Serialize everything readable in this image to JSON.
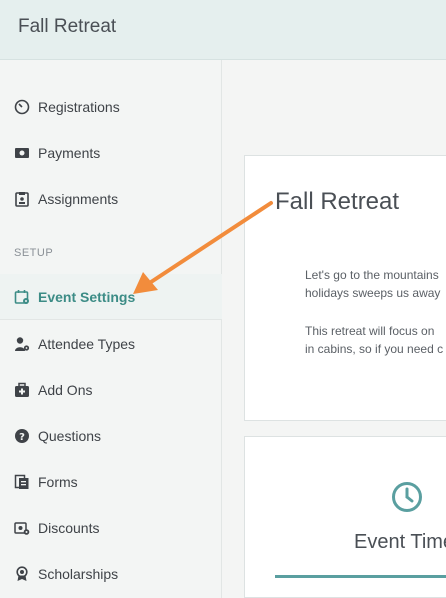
{
  "header": {
    "title": "Fall Retreat"
  },
  "sidebar": {
    "items": [
      {
        "label": "Registrations",
        "icon": "gauge-icon"
      },
      {
        "label": "Payments",
        "icon": "money-icon"
      },
      {
        "label": "Assignments",
        "icon": "assignment-icon"
      }
    ],
    "section": "SETUP",
    "setup_items": [
      {
        "label": "Event Settings",
        "icon": "calendar-gear-icon",
        "active": true
      },
      {
        "label": "Attendee Types",
        "icon": "user-gear-icon"
      },
      {
        "label": "Add Ons",
        "icon": "medkit-icon"
      },
      {
        "label": "Questions",
        "icon": "question-circle-icon"
      },
      {
        "label": "Forms",
        "icon": "forms-icon"
      },
      {
        "label": "Discounts",
        "icon": "discount-icon"
      },
      {
        "label": "Scholarships",
        "icon": "award-icon"
      }
    ]
  },
  "main": {
    "card": {
      "title": "Fall Retreat",
      "para1_line1": "Let's go to the mountains",
      "para1_line2": "holidays sweeps us away",
      "para2_line1": "This retreat will focus on",
      "para2_line2": "in cabins, so if you need c"
    },
    "timeline": {
      "title": "Event Time"
    }
  },
  "colors": {
    "accent": "#3c8c86",
    "arrow": "#f28c3c",
    "header_bg": "#e5efee"
  }
}
